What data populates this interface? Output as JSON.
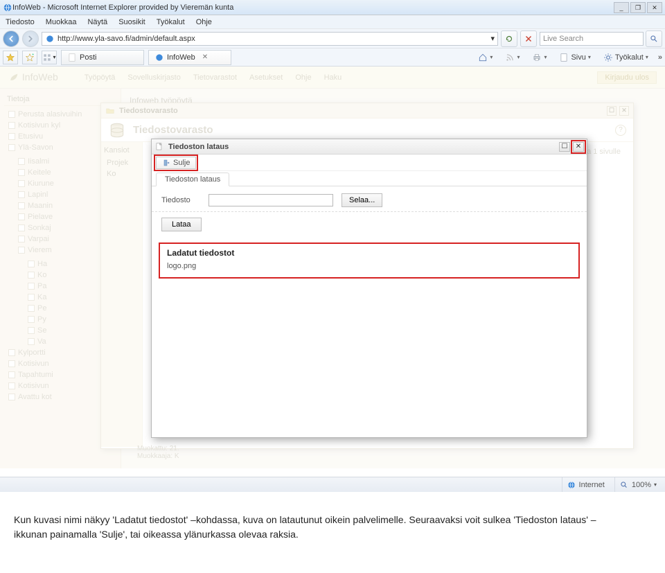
{
  "window": {
    "title": "InfoWeb - Microsoft Internet Explorer provided by Vieremän kunta",
    "min": "_",
    "restore": "❐",
    "close": "✕"
  },
  "menubar": {
    "tiedosto": "Tiedosto",
    "muokkaa": "Muokkaa",
    "nayta": "Näytä",
    "suosikit": "Suosikit",
    "tyokalut": "Työkalut",
    "ohje": "Ohje"
  },
  "address": {
    "url": "http://www.yla-savo.fi/admin/default.aspx",
    "refresh": "⟳",
    "stop": "✕"
  },
  "search": {
    "placeholder": "Live Search"
  },
  "tabs": {
    "posti": "Posti",
    "infoweb": "InfoWeb"
  },
  "toolbar_right": {
    "sivu": "Sivu",
    "tyokalut": "Työkalut"
  },
  "app": {
    "logo": "InfoWeb",
    "nav": {
      "tyopoyta": "Työpöytä",
      "sovelluskirjasto": "Sovelluskirjasto",
      "tietovarastot": "Tietovarastot",
      "asetukset": "Asetukset",
      "ohje": "Ohje",
      "haku": "Haku"
    },
    "logout": "Kirjaudu ulos"
  },
  "sidebar": {
    "title": "Tietoja",
    "items": [
      "Perusta alasivuihin",
      "Kotisivun kyl",
      "Etusivu",
      "Ylä-Savon",
      "Iisalmi",
      "Keitele",
      "Kiurune",
      "Lapinl",
      "Maanin",
      "Pielave",
      "Sonkaj",
      "Varpai",
      "Vierem",
      "Ha",
      "Ko",
      "Pa",
      "Ka",
      "Pe",
      "Py",
      "Se",
      "Va",
      "Kylportti",
      "Kotisivun",
      "Tapahtumi",
      "Kotisivun",
      "Avattu kot"
    ]
  },
  "main": {
    "title": "Infoweb työpöytä"
  },
  "filestore": {
    "win_title": "Tiedostovarasto",
    "header": "Tiedostovarasto",
    "left_header": "Kansiot",
    "tree": [
      "Projek",
      "Ko"
    ],
    "info": "tta 1 sivulle",
    "bottom1": "Muokattu: 21.",
    "bottom2": "Muokkaaja: K"
  },
  "upload": {
    "title": "Tiedoston lataus",
    "sulje": "Sulje",
    "tab": "Tiedoston lataus",
    "field_label": "Tiedosto",
    "browse": "Selaa...",
    "load": "Lataa",
    "loaded_label": "Ladatut tiedostot",
    "loaded_file": "logo.png"
  },
  "status": {
    "zone": "Internet",
    "zoom": "100%"
  },
  "caption": {
    "text": "Kun kuvasi nimi näkyy 'Ladatut tiedostot' –kohdassa, kuva on latautunut oikein palvelimelle. Seuraavaksi voit sulkea 'Tiedoston lataus' –ikkunan painamalla 'Sulje', tai oikeassa ylänurkassa olevaa raksia."
  }
}
